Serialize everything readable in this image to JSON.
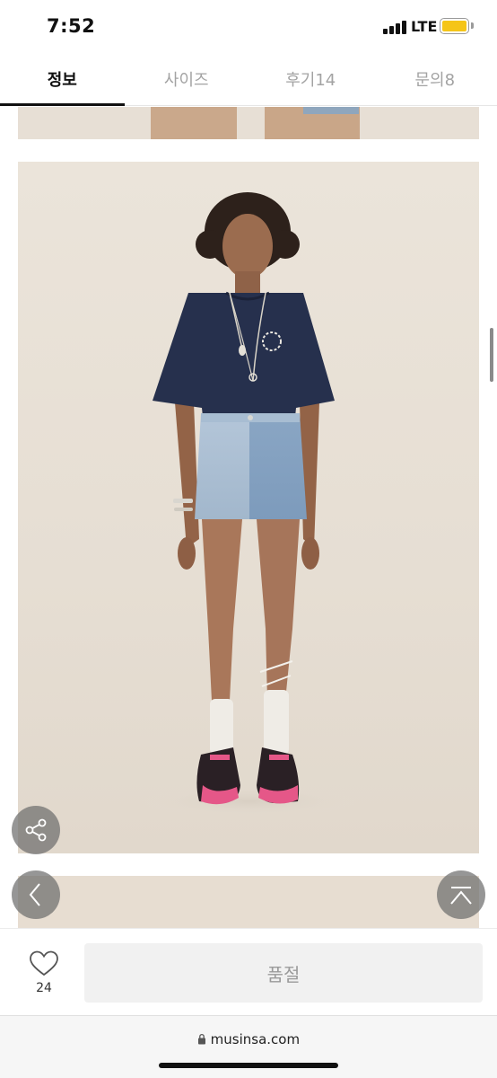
{
  "status_bar": {
    "time": "7:52",
    "network": "LTE",
    "battery_color": "#f5c518"
  },
  "tabs": [
    {
      "label": "정보",
      "active": true
    },
    {
      "label": "사이즈",
      "active": false
    },
    {
      "label": "후기14",
      "active": false
    },
    {
      "label": "문의8",
      "active": false
    }
  ],
  "floating_buttons": {
    "share_icon": "share-icon",
    "back_icon": "chevron-left-icon",
    "top_icon": "scroll-to-top-icon"
  },
  "action_bar": {
    "like_icon": "heart-icon",
    "like_count": "24",
    "soldout_label": "품절"
  },
  "browser": {
    "lock_icon": "lock-icon",
    "url": "musinsa.com"
  }
}
